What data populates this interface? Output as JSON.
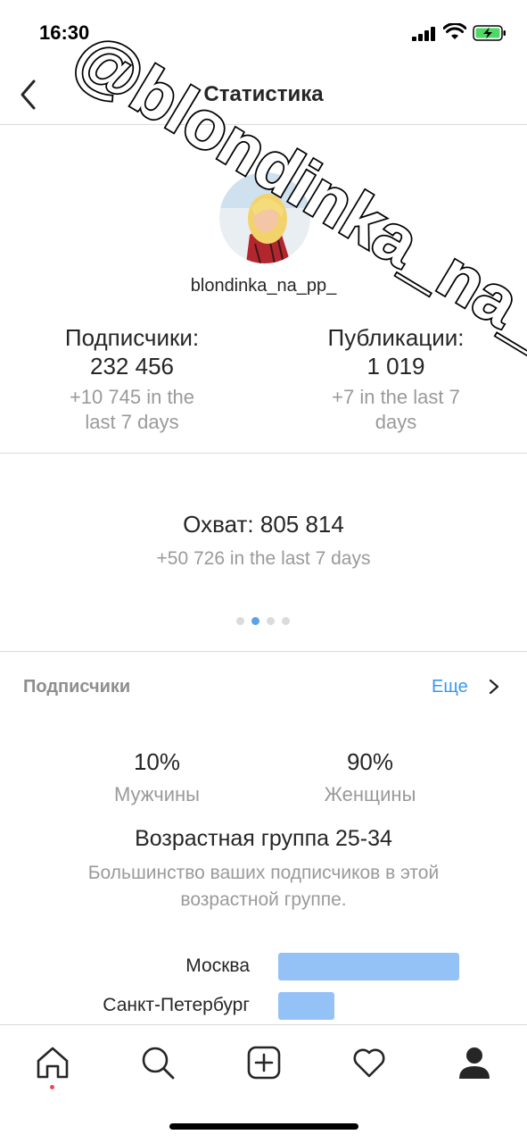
{
  "status_bar": {
    "time": "16:30"
  },
  "nav": {
    "title": "Статистика"
  },
  "profile": {
    "username": "blondinka_na_pp_",
    "followers": {
      "label": "Подписчики:",
      "value": "232 456",
      "delta": "+10 745 in the last 7 days"
    },
    "posts": {
      "label": "Публикации:",
      "value": "1 019",
      "delta": "+7 in the last 7 days"
    }
  },
  "reach": {
    "value": "Охват: 805 814",
    "delta": "+50 726 in the last 7 days",
    "pager": {
      "count": 4,
      "active": 2
    }
  },
  "followers_section": {
    "title": "Подписчики",
    "more": "Еще",
    "men": {
      "value": "10%",
      "label": "Мужчины"
    },
    "women": {
      "value": "90%",
      "label": "Женщины"
    },
    "age_title": "Возрастная группа 25-34",
    "age_desc": "Большинство ваших подписчиков в этой возрастной группе.",
    "cities": [
      {
        "name": "Москва",
        "share": 1.0
      },
      {
        "name": "Санкт-Петербург",
        "share": 0.31
      }
    ]
  },
  "watermark": {
    "text": "@blondinka_na_pp_"
  },
  "colors": {
    "accent": "#3897f0",
    "bar": "#95c2f6",
    "muted": "#9a9a9a",
    "notification": "#ed4956"
  },
  "tabs": [
    "home-icon",
    "search-icon",
    "new-post-icon",
    "activity-heart-icon",
    "profile-icon"
  ]
}
